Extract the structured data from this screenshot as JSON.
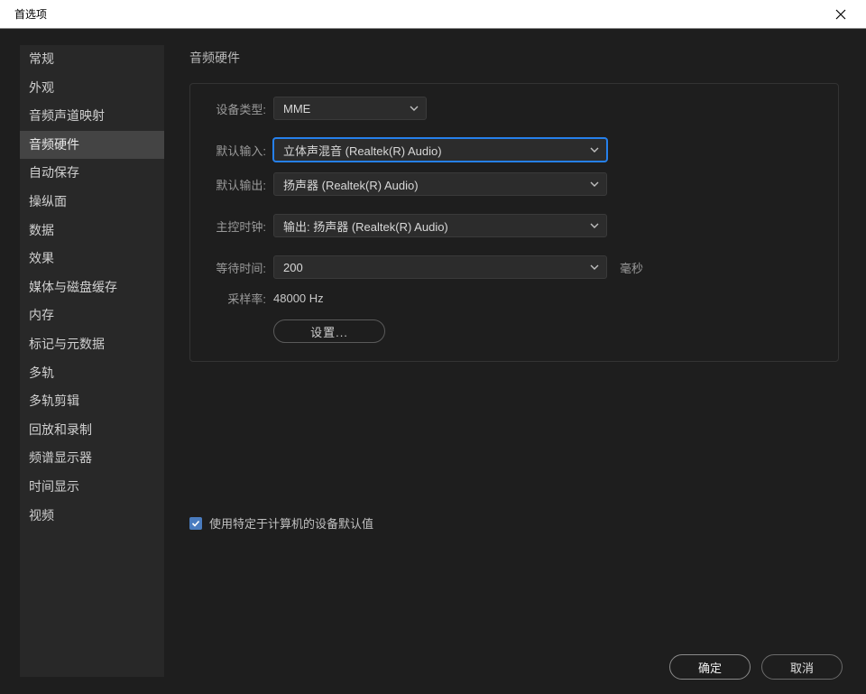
{
  "titlebar": {
    "title": "首选项"
  },
  "sidebar": {
    "items": [
      {
        "label": "常规"
      },
      {
        "label": "外观"
      },
      {
        "label": "音频声道映射"
      },
      {
        "label": "音频硬件",
        "selected": true
      },
      {
        "label": "自动保存"
      },
      {
        "label": "操纵面"
      },
      {
        "label": "数据"
      },
      {
        "label": "效果"
      },
      {
        "label": "媒体与磁盘缓存"
      },
      {
        "label": "内存"
      },
      {
        "label": "标记与元数据"
      },
      {
        "label": "多轨"
      },
      {
        "label": "多轨剪辑"
      },
      {
        "label": "回放和录制"
      },
      {
        "label": "频谱显示器"
      },
      {
        "label": "时间显示"
      },
      {
        "label": "视频"
      }
    ]
  },
  "panel": {
    "title": "音频硬件",
    "device_type": {
      "label": "设备类型:",
      "value": "MME"
    },
    "default_input": {
      "label": "默认输入:",
      "value": "立体声混音 (Realtek(R) Audio)"
    },
    "default_output": {
      "label": "默认输出:",
      "value": "扬声器 (Realtek(R) Audio)"
    },
    "master_clock": {
      "label": "主控时钟:",
      "value": "输出: 扬声器 (Realtek(R) Audio)"
    },
    "latency": {
      "label": "等待时间:",
      "value": "200",
      "suffix": "毫秒"
    },
    "sample_rate": {
      "label": "采样率:",
      "value": "48000 Hz"
    },
    "settings_btn": "设置..."
  },
  "checkbox": {
    "label": "使用特定于计算机的设备默认值",
    "checked": true
  },
  "footer": {
    "ok": "确定",
    "cancel": "取消"
  }
}
